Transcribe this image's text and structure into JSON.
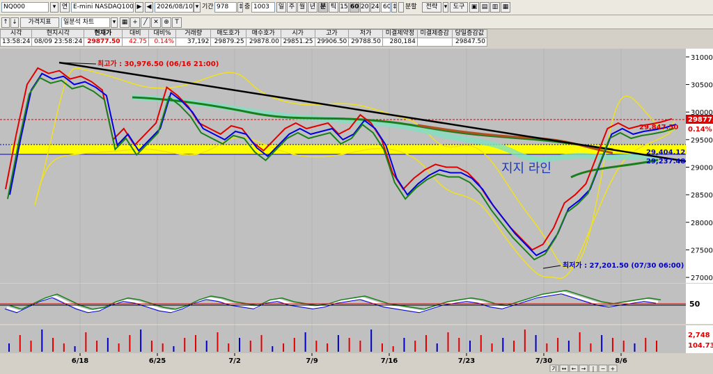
{
  "toolbar": {
    "symbol": "NQ000",
    "lookup_label": "연",
    "product_name": "E-mini NASDAQ100(26-0",
    "date": "2026/08/10",
    "period_label": "기간",
    "period_value": "978",
    "count_value": "1003",
    "count_label": "중",
    "periods": [
      "일",
      "주",
      "월",
      "년",
      "분",
      "틱"
    ],
    "active_period": "분",
    "intervals": [
      "15",
      "60",
      "200",
      "240",
      "60"
    ],
    "active_interval": "60",
    "split_label": "분할",
    "strategy_label": "전략",
    "tools_label": "도구"
  },
  "toolbar2": {
    "indicator_label": "가격지표",
    "chart_type": "일분석 차트"
  },
  "quote": {
    "headers": [
      "시각",
      "현지시각",
      "현재가",
      "대비",
      "대비%",
      "거래량",
      "매도호가",
      "매수호가",
      "시가",
      "고가",
      "저가",
      "미결제약정",
      "미결제증감",
      "당일증감값"
    ],
    "values": [
      "13:58:24",
      "08/09 23:58:24",
      "29877.50",
      "42.75",
      "0.14%",
      "37,192",
      "29879.25",
      "29878.00",
      "29851.25",
      "29906.50",
      "29788.50",
      "280,184",
      "",
      "29847.50"
    ]
  },
  "chart_data": [
    {
      "type": "line",
      "x_ticks": [
        "6/18",
        "6/25",
        "7/2",
        "7/9",
        "7/16",
        "7/23",
        "7/30",
        "8/6"
      ],
      "y_ticks": [
        31000,
        30500,
        30000,
        29500,
        29000,
        28500,
        28000,
        27500,
        27000
      ],
      "ylim": [
        26900,
        31150
      ],
      "close": [
        28600,
        29600,
        30500,
        30800,
        30700,
        30750,
        30600,
        30650,
        30550,
        30400,
        29500,
        29700,
        29400,
        29600,
        29800,
        30450,
        30300,
        30100,
        29800,
        29700,
        29600,
        29750,
        29700,
        29450,
        29300,
        29500,
        29700,
        29800,
        29700,
        29750,
        29800,
        29600,
        29700,
        29950,
        29800,
        29500,
        28900,
        28600,
        28800,
        28950,
        29050,
        29000,
        29000,
        28900,
        28700,
        28400,
        28150,
        27900,
        27700,
        27500,
        27600,
        27900,
        28350,
        28500,
        28700,
        29200,
        29700,
        29800,
        29700,
        29750,
        29780,
        29820,
        29877.5
      ],
      "annotations": {
        "high_label": "최고가 : 30,976.50 (06/16 21:00)",
        "low_label": "최저가 : 27,201.50 (07/30 06:00)",
        "support_label": "지지 라인",
        "current_price": "29877.50",
        "change_pct": "0.14%",
        "level_1": "29,847.50",
        "level_2": "29,404.12",
        "level_3": "29,237.48"
      },
      "colors": {
        "price": "#e00000",
        "ma_green": "#1a7f1a",
        "ma_blue": "#0000e0",
        "band": "#f0e020",
        "trend": "#000000",
        "support_zone": "#ffff00"
      }
    },
    {
      "type": "line",
      "y_ticks": [
        50
      ],
      "series": [
        {
          "values": [
            40,
            30,
            45,
            60,
            70,
            55,
            40,
            30,
            35,
            50,
            60,
            55,
            45,
            35,
            30,
            40,
            55,
            65,
            60,
            50,
            45,
            40,
            55,
            60,
            50,
            45,
            40,
            45,
            55,
            60,
            65,
            55,
            45,
            40,
            35,
            30,
            40,
            50,
            55,
            60,
            55,
            45,
            40,
            50,
            60,
            70,
            75,
            80,
            70,
            60,
            50,
            45,
            50,
            55,
            60,
            55
          ]
        }
      ]
    },
    {
      "type": "bar",
      "y_ticks_labels": [
        "2,748",
        "104.73"
      ],
      "values": [
        3,
        6,
        4,
        8,
        5,
        3,
        2,
        7,
        4,
        5,
        3,
        6,
        8,
        4,
        3,
        2,
        5,
        6,
        4,
        7,
        3,
        5,
        4,
        6,
        2,
        3,
        5,
        7,
        4,
        3,
        6,
        5,
        4,
        8,
        3,
        2,
        5,
        4,
        6,
        3,
        7,
        5,
        4,
        6,
        3,
        5,
        4,
        8,
        6,
        3,
        5,
        4,
        7,
        3,
        6,
        5,
        4,
        3,
        5,
        4
      ]
    }
  ],
  "bottom_controls": [
    "기",
    "↔",
    "←",
    "→",
    "|",
    "−",
    "+"
  ]
}
